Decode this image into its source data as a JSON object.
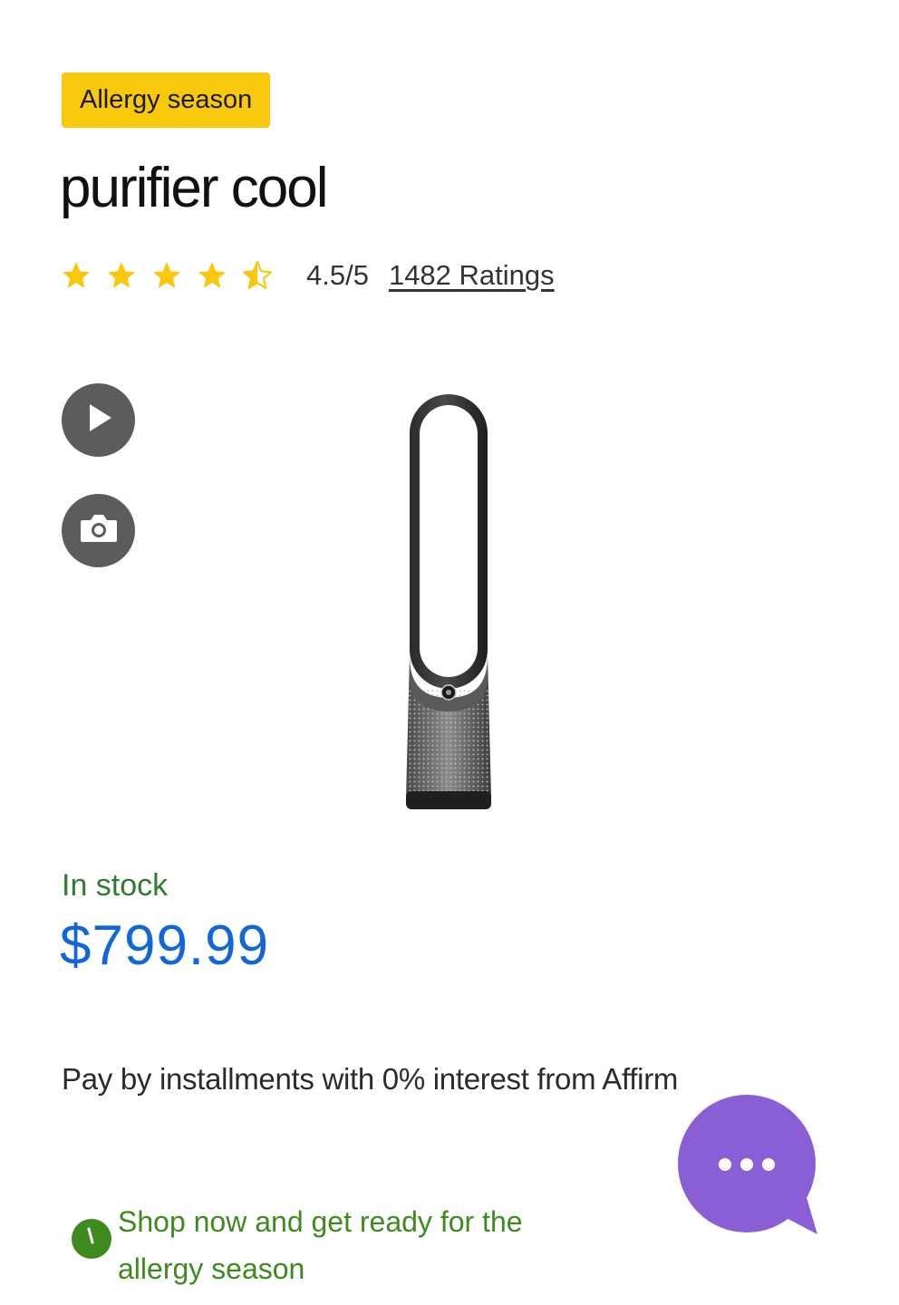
{
  "badge": {
    "label": "Allergy season",
    "color": "#f7c80b"
  },
  "product": {
    "title": "purifier cool",
    "image_icon": "tower-purifier-fan-image"
  },
  "rating": {
    "stars": 4.5,
    "max_stars": 5,
    "score_text": "4.5/5",
    "count_text": "1482 Ratings",
    "star_color": "#f7c80b"
  },
  "media": {
    "video_icon": "play-icon",
    "photo_icon": "camera-icon"
  },
  "availability": {
    "text": "In stock",
    "color": "#2f7d32"
  },
  "price": {
    "text": "$799.99",
    "color": "#1266d6"
  },
  "financing": {
    "text": "Pay by installments with 0% interest from Affirm"
  },
  "promo": {
    "icon": "clock-icon",
    "text": "Shop now and get ready for the allergy season",
    "color": "#3f8a1f"
  },
  "chat": {
    "icon": "chat-bubble-icon",
    "color": "#8a5fd6"
  }
}
